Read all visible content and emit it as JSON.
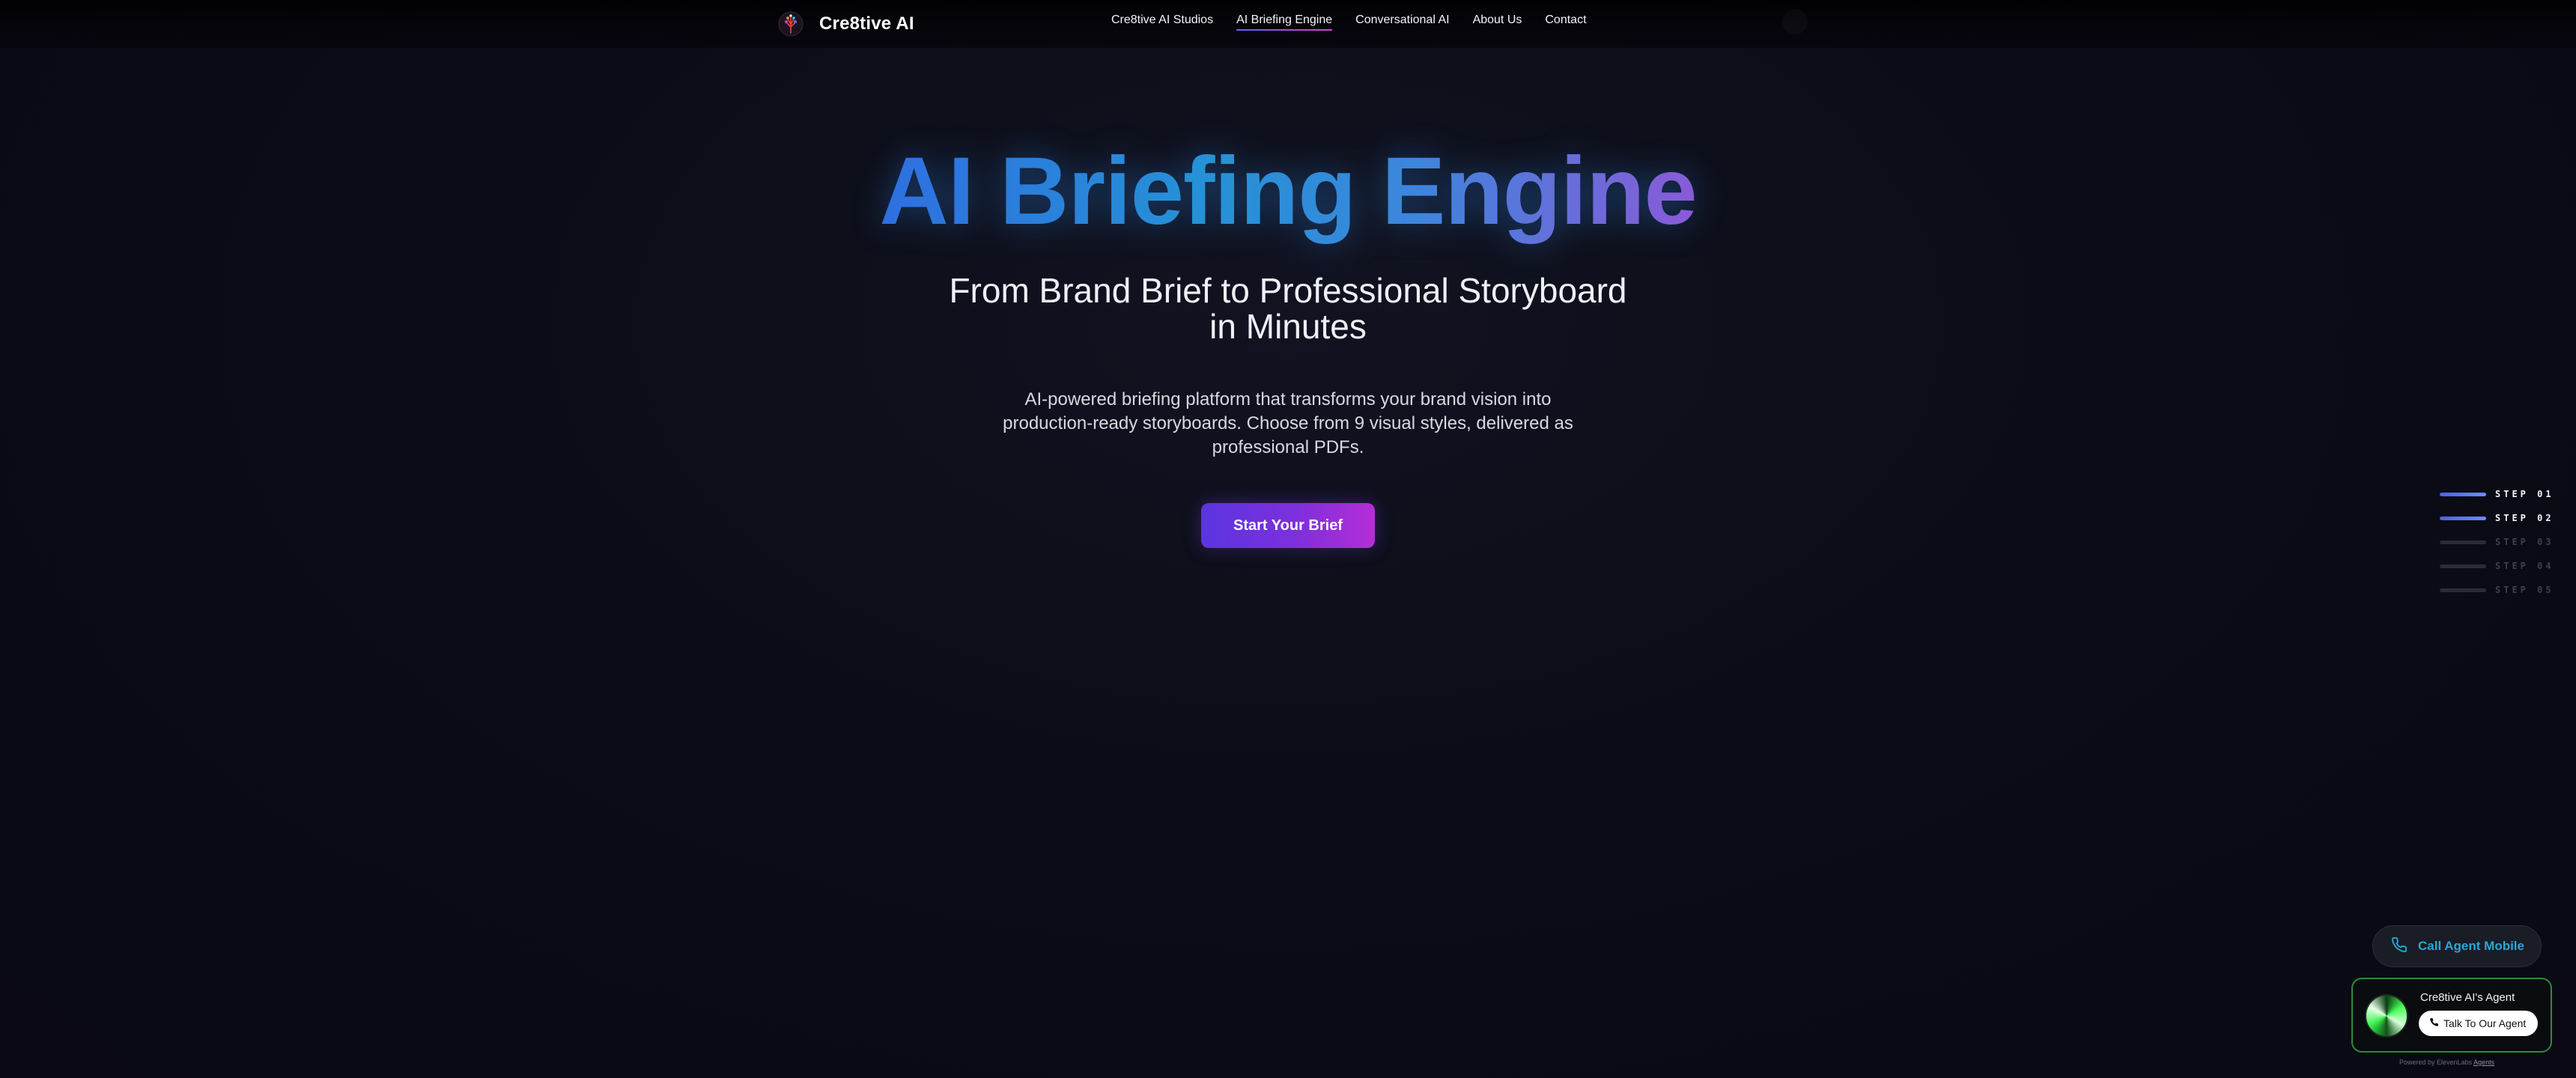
{
  "brand": {
    "name": "Cre8tive AI",
    "logo_icon": "tree-logo-icon"
  },
  "nav": {
    "links": [
      {
        "label": "Cre8tive AI Studios",
        "active": false
      },
      {
        "label": "AI Briefing Engine",
        "active": true
      },
      {
        "label": "Conversational AI",
        "active": false
      },
      {
        "label": "About Us",
        "active": false
      },
      {
        "label": "Contact",
        "active": false
      }
    ]
  },
  "hero": {
    "title": "AI Briefing Engine",
    "subtitle_line1": "From Brand Brief to Professional Storyboard",
    "subtitle_line2": "in Minutes",
    "desc_line1": "AI-powered briefing platform that transforms your brand vision into",
    "desc_line2": "production-ready storyboards. Choose from 9 visual styles, delivered as",
    "desc_line3": "professional PDFs.",
    "cta_label": "Start Your Brief"
  },
  "steps": [
    {
      "label": "STEP 01",
      "active": true
    },
    {
      "label": "STEP 02",
      "active": true
    },
    {
      "label": "STEP 03",
      "active": false
    },
    {
      "label": "STEP 04",
      "active": false
    },
    {
      "label": "STEP 05",
      "active": false
    }
  ],
  "agent": {
    "call_mobile_label": "Call Agent Mobile",
    "call_icon": "phone-icon",
    "name": "Cre8tive AI's Agent",
    "talk_label": "Talk To Our Agent",
    "powered_text": "Powered by ElevenLabs",
    "powered_link": "Agents"
  },
  "colors": {
    "accent_purple": "#7d2fdc",
    "accent_blue": "#2592d6",
    "agent_border_green": "#2f8a3e",
    "background": "#0b0c16"
  }
}
